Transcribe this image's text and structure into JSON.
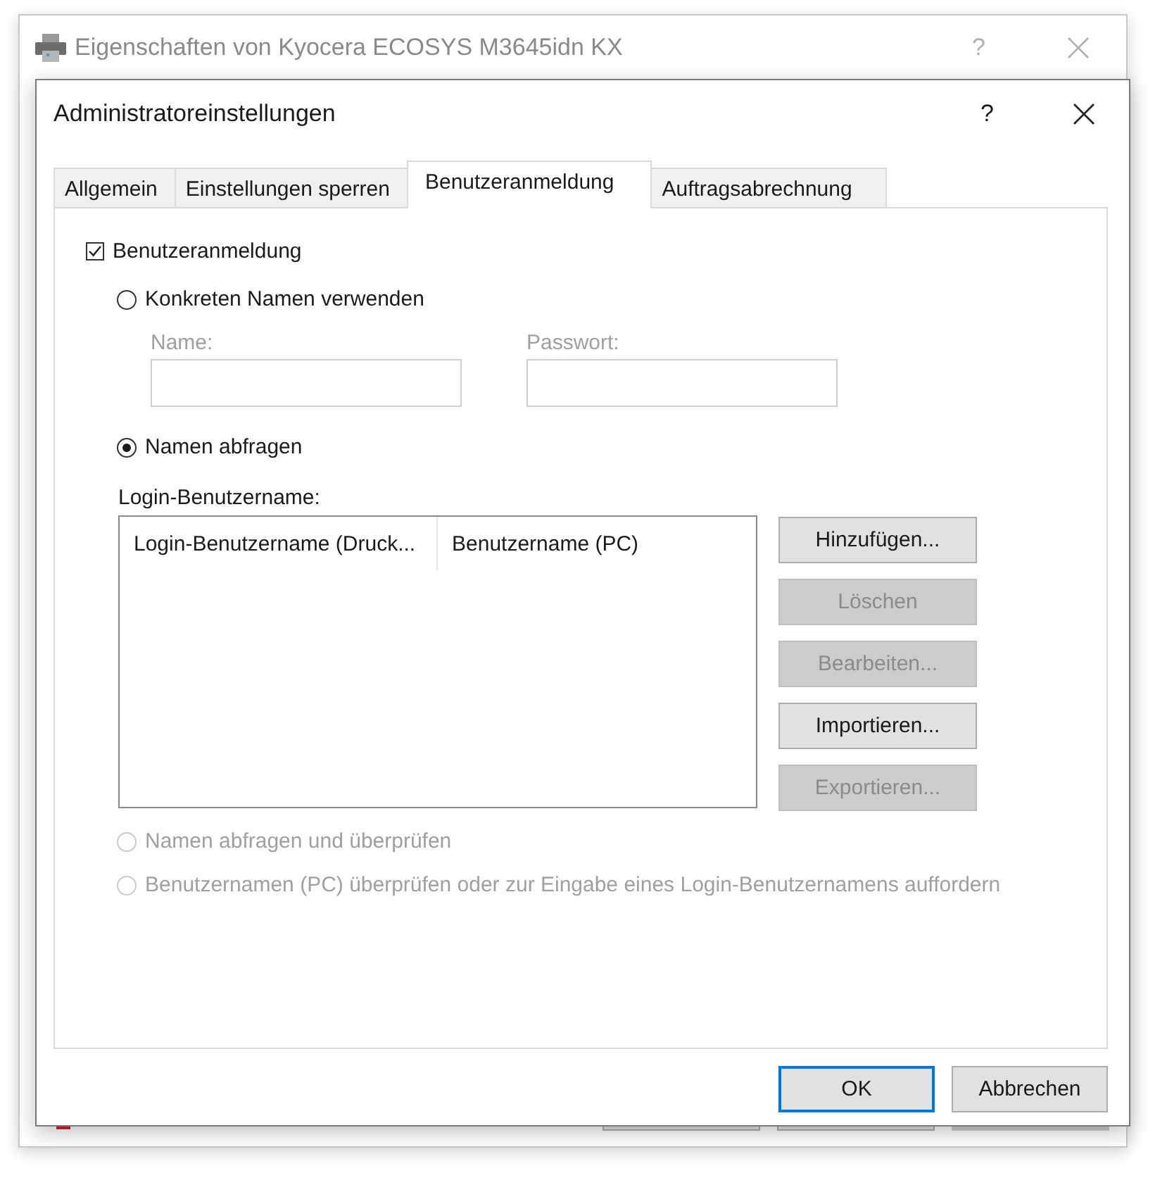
{
  "back_window": {
    "title": "Eigenschaften von Kyocera ECOSYS M3645idn KX",
    "help": "?"
  },
  "dialog": {
    "title": "Administratoreinstellungen",
    "help": "?"
  },
  "tabs": [
    {
      "label": "Allgemein",
      "selected": false
    },
    {
      "label": "Einstellungen sperren",
      "selected": false
    },
    {
      "label": "Benutzeranmeldung",
      "selected": true
    },
    {
      "label": "Auftragsabrechnung",
      "selected": false
    }
  ],
  "user_login": {
    "label": "Benutzeranmeldung",
    "checked": true
  },
  "specific_name": {
    "label": "Konkreten Namen verwenden",
    "selected": false,
    "disabled": false
  },
  "fields": [
    {
      "label": "Name:",
      "disabled": true
    },
    {
      "label": "Passwort:",
      "disabled": true
    }
  ],
  "query_name": {
    "label": "Namen abfragen",
    "selected": true,
    "disabled": false
  },
  "login_list": {
    "label": "Login-Benutzername:",
    "columns": [
      "Login-Benutzername (Druck...",
      "Benutzername (PC)"
    ]
  },
  "list_buttons": [
    {
      "label": "Hinzufügen...",
      "disabled": false
    },
    {
      "label": "Löschen",
      "disabled": true
    },
    {
      "label": "Bearbeiten...",
      "disabled": true
    },
    {
      "label": "Importieren...",
      "disabled": false
    },
    {
      "label": "Exportieren...",
      "disabled": true
    }
  ],
  "more_options": [
    {
      "label": "Namen abfragen und überprüfen",
      "selected": false,
      "disabled": true
    },
    {
      "label": "Benutzernamen (PC) überprüfen oder zur Eingabe eines Login-Benutzernamens auffordern",
      "selected": false,
      "disabled": true
    }
  ],
  "footer_buttons": [
    {
      "label": "OK",
      "default": true
    },
    {
      "label": "Abbrechen",
      "default": false
    }
  ]
}
